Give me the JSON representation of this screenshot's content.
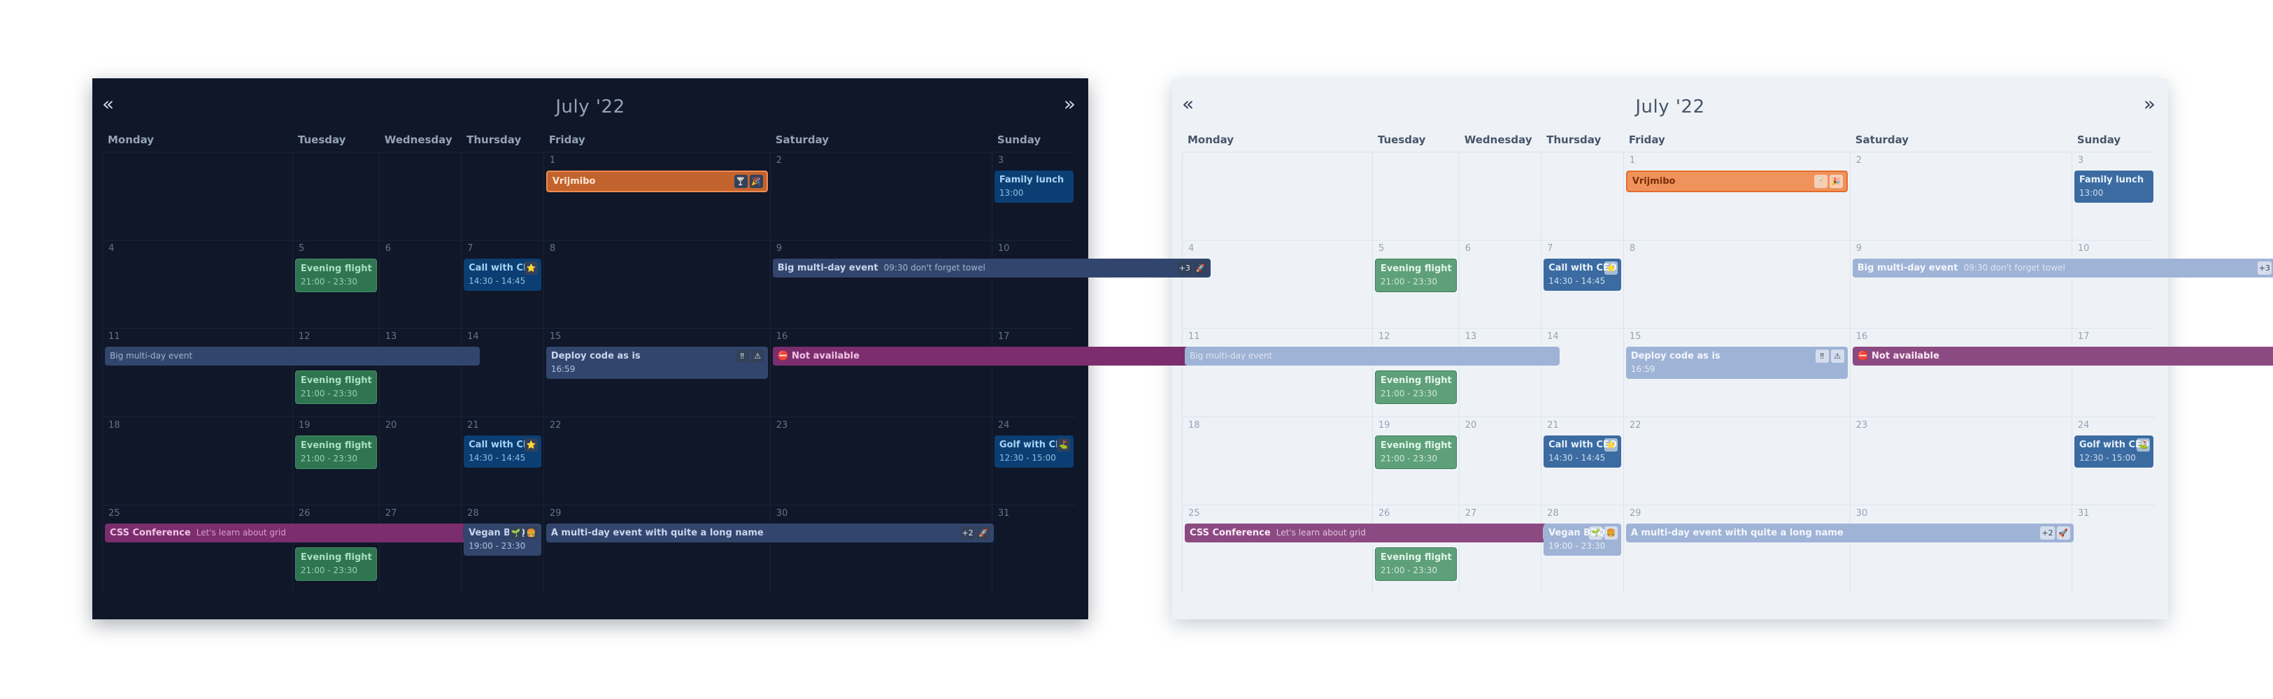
{
  "calendar": {
    "title": "July '22",
    "prev_icon": "«",
    "next_icon": "»",
    "weekdays": [
      "Monday",
      "Tuesday",
      "Wednesday",
      "Thursday",
      "Friday",
      "Saturday",
      "Sunday"
    ],
    "days": [
      "1",
      "2",
      "3",
      "4",
      "5",
      "6",
      "7",
      "8",
      "9",
      "10",
      "11",
      "12",
      "13",
      "14",
      "15",
      "16",
      "17",
      "18",
      "19",
      "20",
      "21",
      "22",
      "23",
      "24",
      "25",
      "26",
      "27",
      "28",
      "29",
      "30",
      "31"
    ]
  },
  "events": {
    "vrijmibo": {
      "title": "Vrijmibo",
      "tags": [
        "🍸",
        "🎉"
      ]
    },
    "family_lunch": {
      "title": "Family lunch",
      "time": "13:00"
    },
    "evening_flight": {
      "title": "Evening flight",
      "time": "21:00 - 23:30"
    },
    "call_ceo": {
      "title": "Call with CEO",
      "time": "14:30 - 14:45",
      "tag": "⭐"
    },
    "big_multi_day": {
      "title": "Big multi-day event",
      "subtitle": "09:30 don't forget towel",
      "tags": [
        "+3",
        "🚀"
      ]
    },
    "big_multi_day_cont": {
      "title": "Big multi-day event"
    },
    "deploy": {
      "title": "Deploy code as is",
      "time": "16:59",
      "tags": [
        "‼",
        "⚠"
      ]
    },
    "not_available": {
      "title": "Not available",
      "icon": "⛔"
    },
    "golf_ceo": {
      "title": "Golf with CEO",
      "time": "12:30 - 15:00",
      "tag": "⛳"
    },
    "css_conf": {
      "title": "CSS Conference",
      "subtitle": "Let's learn about grid",
      "tag": "😄"
    },
    "vegan_bbq": {
      "title": "Vegan BBQ",
      "time": "19:00 - 23:30",
      "tags": [
        "🌱",
        "🍔"
      ]
    },
    "multi_long": {
      "title": "A multi-day event with quite a long name",
      "tags": [
        "+2",
        "🚀"
      ]
    }
  },
  "colors": {
    "dark_bg": "#0f1729",
    "light_bg": "#eef2f7",
    "orange": "#c2632d",
    "green": "#2f7550",
    "blue": "#0b3f73",
    "slate": "#32466d",
    "purple": "#7c2d6d"
  }
}
